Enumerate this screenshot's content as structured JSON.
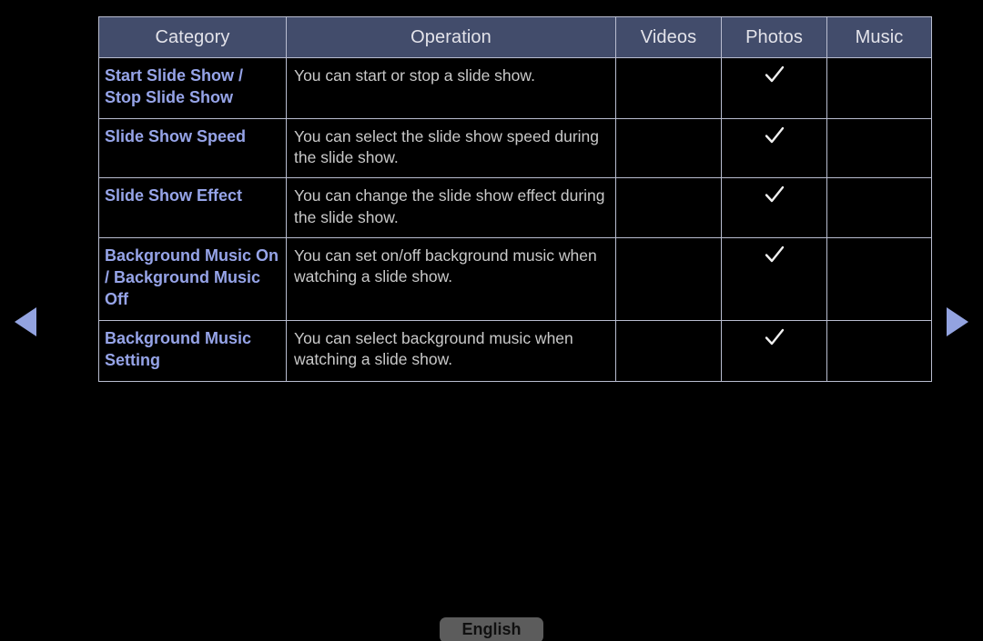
{
  "nav": {
    "prev_label": "◀",
    "next_label": "▶"
  },
  "table": {
    "headers": {
      "category": "Category",
      "operation": "Operation",
      "videos": "Videos",
      "photos": "Photos",
      "music": "Music"
    },
    "rows": [
      {
        "category": "Start Slide Show / Stop Slide Show",
        "operation": "You can start or stop a slide show.",
        "videos": "",
        "photos": "✓",
        "music": ""
      },
      {
        "category": "Slide Show Speed",
        "operation": "You can select the slide show speed during the slide show.",
        "videos": "",
        "photos": "✓",
        "music": ""
      },
      {
        "category": "Slide Show Effect",
        "operation": "You can change the slide show effect during the slide show.",
        "videos": "",
        "photos": "✓",
        "music": ""
      },
      {
        "category": "Background Music On / Background Music Off",
        "operation": "You can set on/off background music when watching a slide show.",
        "videos": "",
        "photos": "✓",
        "music": ""
      },
      {
        "category": "Background Music Setting",
        "operation": "You can select background music when watching a slide show.",
        "videos": "",
        "photos": "✓",
        "music": ""
      }
    ]
  },
  "footer": {
    "language_label": "English"
  },
  "colors": {
    "background": "#000000",
    "header_bg": "#424c6b",
    "header_text": "#e3e3ea",
    "category_text": "#96a4e8",
    "operation_text": "#c9c9c9",
    "border": "#b9bdd0",
    "arrow": "#93a3e0",
    "button_bg": "#5c5c5c",
    "button_text": "#101010",
    "check": "#f0f0f0"
  }
}
